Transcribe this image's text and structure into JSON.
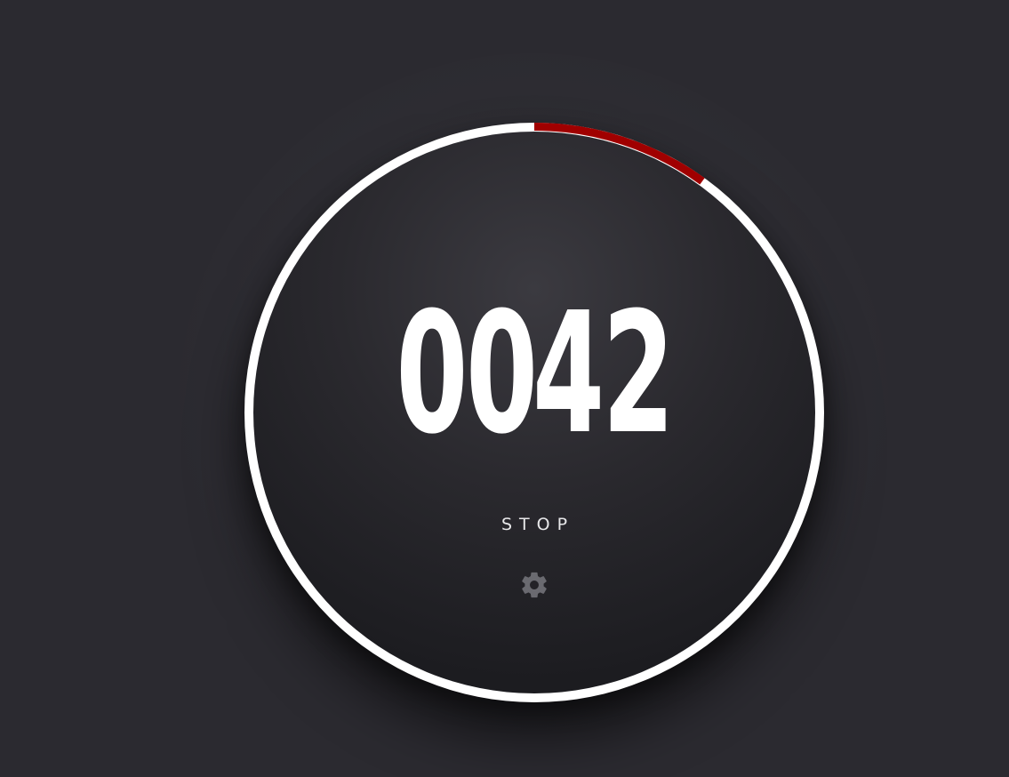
{
  "timer": {
    "minutes": "00",
    "seconds": "42",
    "stop_label": "STOP",
    "progress_fraction": 0.1,
    "progress_color": "#a00000",
    "ring_color": "#ffffff"
  },
  "icons": {
    "settings": "gear-icon"
  }
}
